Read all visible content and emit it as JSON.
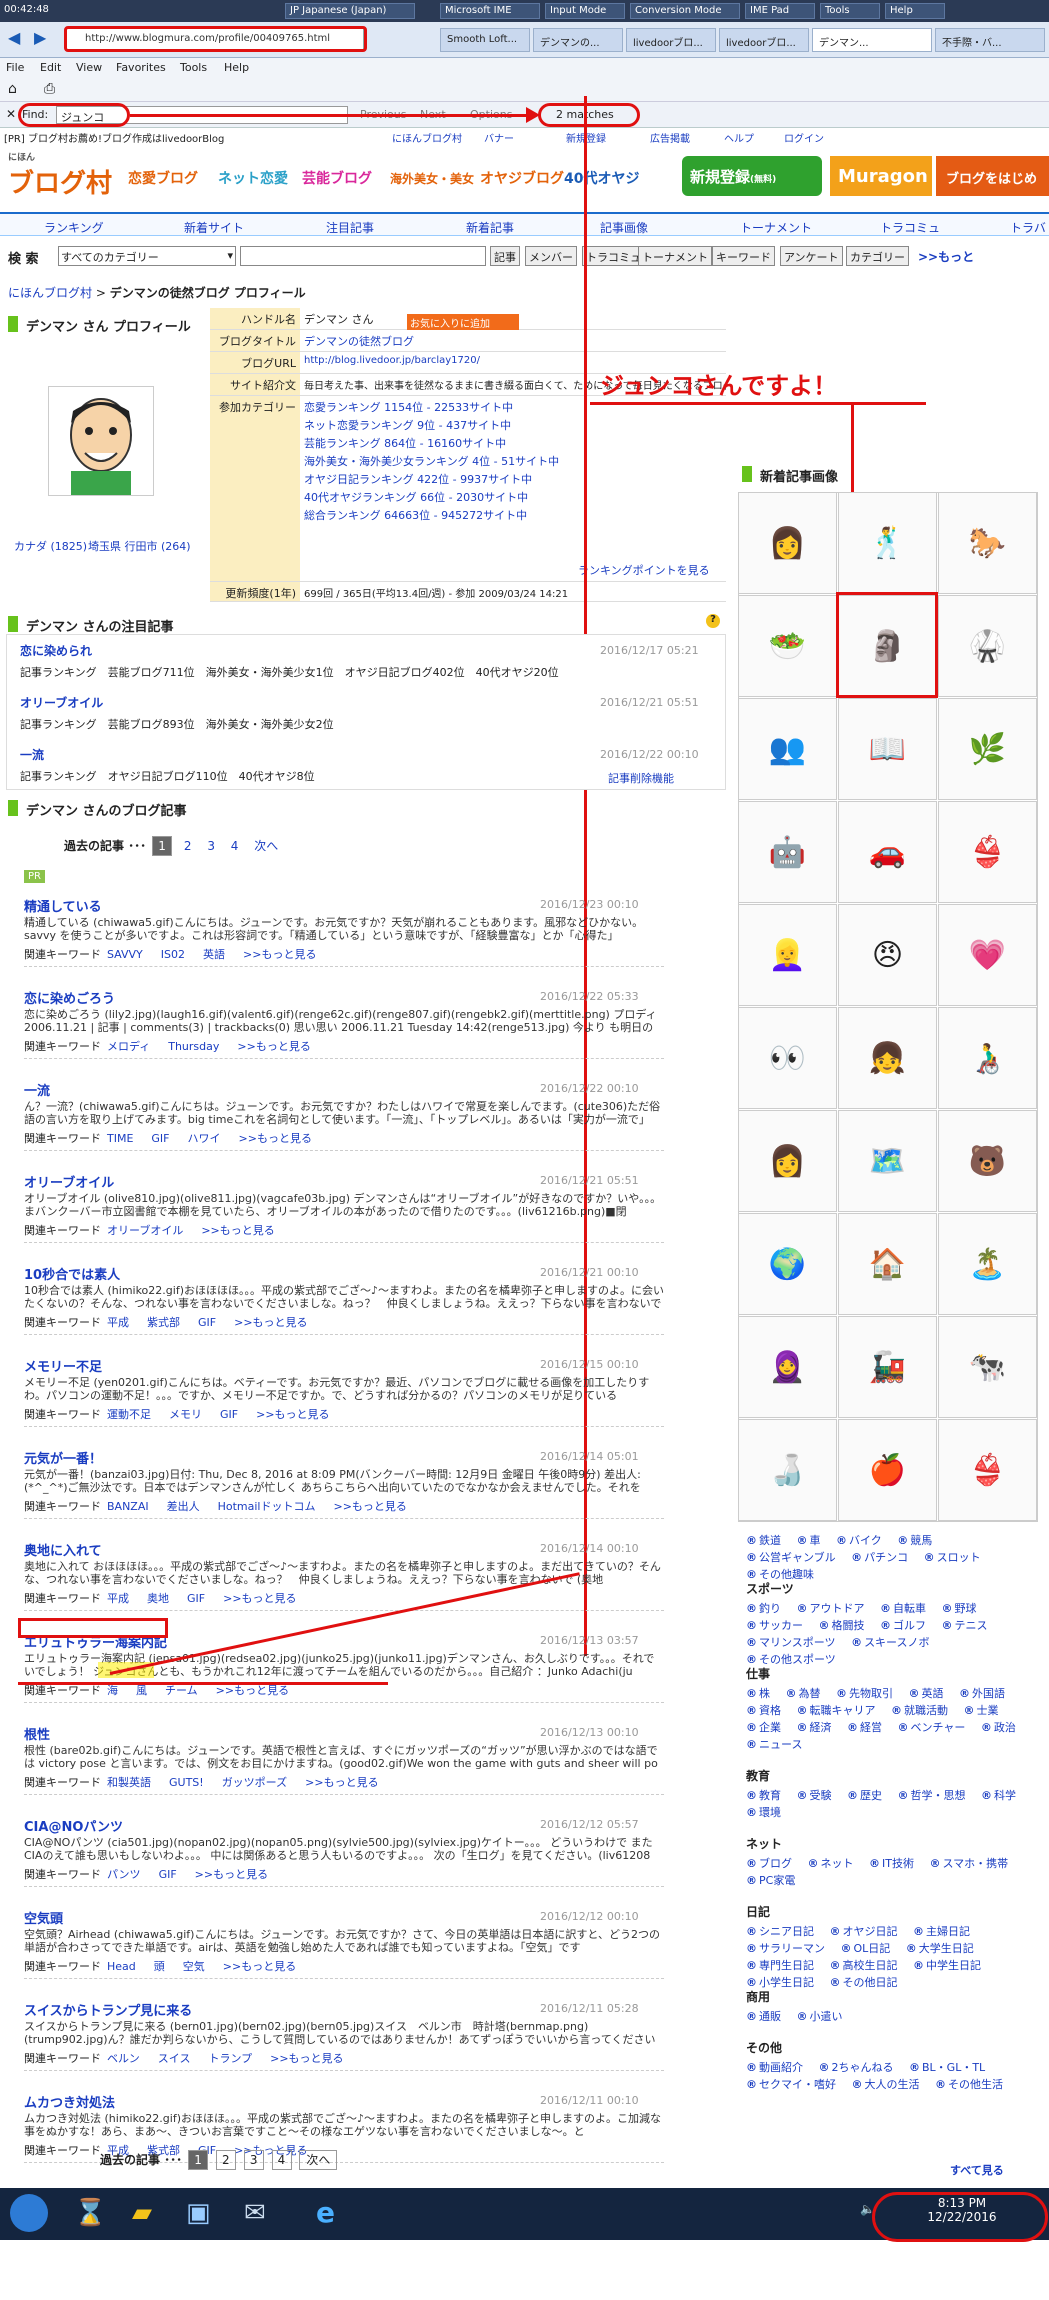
{
  "topbar": {
    "time": "00:42:48",
    "lang": "JP Japanese (Japan)",
    "ime": "Microsoft IME",
    "input_mode": "Input Mode",
    "conv_mode": "Conversion Mode",
    "ime_pad": "IME Pad",
    "tools": "Tools",
    "help": "Help"
  },
  "browser": {
    "url": "http://www.blogmura.com/profile/00409765.html",
    "tabs": [
      "Smooth Loft...",
      "デンマンの...",
      "livedoorブロ...",
      "livedoorブロ...",
      "デンマン...",
      "不手際・バ..."
    ],
    "menu": [
      "File",
      "Edit",
      "View",
      "Favorites",
      "Tools",
      "Help"
    ],
    "find_label": "Find:",
    "find_value": "ジュンコ",
    "find_prev": "Previous",
    "find_next": "Next",
    "find_options": "Options",
    "find_matches": "2 matches"
  },
  "site": {
    "pr_text": "[PR] ブログ村お薦め!ブログ作成はlivedoorBlog",
    "top_links": [
      "にほんブログ村",
      "バナー",
      "新規登録",
      "広告掲載",
      "ヘルプ",
      "ログイン"
    ],
    "logo": "ブログ村",
    "logo_sub": "にほん",
    "categories": [
      "恋愛ブログ",
      "ネット恋愛",
      "芸能ブログ",
      "海外美女・美女",
      "オヤジブログ",
      "40代オヤジ"
    ],
    "register": "新規登録",
    "register_sub": "(無料)",
    "muragon": "Muragon",
    "blog_start": "ブログをはじめ",
    "nav": [
      "ランキング",
      "新着サイト",
      "注目記事",
      "新着記事",
      "記事画像",
      "トーナメント",
      "トラコミュ",
      "トラバ"
    ],
    "search_label": "検 索",
    "search_select": "すべてのカテゴリー",
    "search_buttons": [
      "記事",
      "メンバー",
      "トラコミュ",
      "トーナメント",
      "キーワード",
      "アンケート",
      "カテゴリー"
    ],
    "search_more": ">>もっと",
    "breadcrumb_home": "にほんブログ村",
    "breadcrumb_current": "デンマンの徒然ブログ プロフィール"
  },
  "profile": {
    "title": "デンマン さん プロフィール",
    "handle_label": "ハンドル名",
    "handle": "デンマン さん",
    "add_fav": "お気に入りに追加",
    "blog_title_label": "ブログタイトル",
    "blog_title": "デンマンの徒然ブログ",
    "blog_url_label": "ブログURL",
    "blog_url": "http://blog.livedoor.jp/barclay1720/",
    "intro_label": "サイト紹介文",
    "intro": "毎日考えた事、出来事を徒然なるままに書き綴る面白くて、ためになって毎日見たくなるブログです。",
    "cat_label": "参加カテゴリー",
    "cats": [
      "恋愛ランキング 1154位 - 22533サイト中",
      "ネット恋愛ランキング 9位 - 437サイト中",
      "芸能ランキング 864位 - 16160サイト中",
      "海外美女・海外美少女ランキング 4位 - 51サイト中",
      "オヤジ日記ランキング 422位 - 9937サイト中",
      "40代オヤジランキング 66位 - 2030サイト中",
      "総合ランキング 64663位 - 945272サイト中"
    ],
    "rank_point": "ランキングポイントを見る",
    "freq_label": "更新頻度(1年)",
    "freq": "699回 / 365日(平均13.4回/週) - 参加 2009/03/24 14:21",
    "loc1": "カナダ (1825)",
    "loc2": "埼玉県 行田市 (264)"
  },
  "annotation": "ジュンコさんですよ！",
  "featured": {
    "title": "デンマン さんの注目記事",
    "items": [
      {
        "title": "恋に染められ",
        "date": "2016/12/17 05:21",
        "kw": "記事ランキング　芸能ブログ711位　海外美女・海外美少女1位　オヤジ日記ブログ402位　40代オヤジ20位"
      },
      {
        "title": "オリーブオイル",
        "date": "2016/12/21 05:51",
        "kw": "記事ランキング　芸能ブログ893位　海外美女・海外美少女2位"
      },
      {
        "title": "一流",
        "date": "2016/12/22 00:10",
        "kw": "記事ランキング　オヤジ日記ブログ110位　40代オヤジ8位"
      }
    ],
    "delete_link": "記事削除機能"
  },
  "blog": {
    "title": "デンマン さんのブログ記事",
    "pager_label": "過去の記事 ･･･",
    "pages": [
      "1",
      "2",
      "3",
      "4"
    ],
    "next": "次へ",
    "pr": "PR",
    "kw_label": "関連キーワード",
    "more": ">>もっと見る",
    "articles": [
      {
        "title": "精通している",
        "date": "2016/12/23 00:10",
        "body": "精通している (chiwawa5.gif)こんにちは。ジューンです。お元気ですか？天気が崩れることもあります。風邪などひかない。savvy を使うことが多いですよ。これは形容詞です。「精通している」という意味ですが、「経験豊富な」とか「心得た」",
        "kw": [
          "SAVVY",
          "IS02",
          "英語"
        ]
      },
      {
        "title": "恋に染めごろう",
        "date": "2016/12/22 05:33",
        "body": "恋に染めごろう (lily2.jpg)(laugh16.gif)(valent6.gif)(renge62c.gif)(renge807.gif)(rengebk2.gif)(merttitle.png) プロディ 2006.11.21 | 記事 | comments(3) | trackbacks(0) 思い思い 2006.11.21 Tuesday 14:42(renge513.jpg) 今より も明日の 思いのとめどない",
        "kw": [
          "メロディ",
          "Thursday"
        ]
      },
      {
        "title": "一流",
        "date": "2016/12/22 00:10",
        "body": "ん？一流？(chiwawa5.gif)こんにちは。ジューンです。お元気ですか？わたしはハワイで常夏を楽しんでます。(cute306)ただ俗語の言い方を取り上げてみます。big timeこれを名詞句として使います。「一流」、「トップレベル」。あるいは「実力が一流で」",
        "kw": [
          "TIME",
          "GIF",
          "ハワイ"
        ]
      },
      {
        "title": "オリーブオイル",
        "date": "2016/12/21 05:51",
        "body": "オリーブオイル (olive810.jpg)(olive811.jpg)(vagcafe03b.jpg) デンマンさんは“オリーブオイル”が好きなのですか？いや。。。まバンクーバー市立図書館で本棚を見ていたら、オリーブオイルの本があったので借りたのです。。。(liv61216b.png)■閉",
        "kw": [
          "オリーブオイル"
        ]
      },
      {
        "title": "10秒合では素人",
        "date": "2016/12/21 00:10",
        "body": "10秒合では素人 (himiko22.gif)おほほほほ。。。平成の紫式部でござ～♪～ますわよ。またの名を橘卑弥子と申しますのよ。に会いたくないの？そんな、つれない事を言わないでくださいましな。ねっ？　仲良くしましょうね。ええっ？下らない事を言わないで",
        "kw": [
          "平成",
          "紫式部",
          "GIF"
        ]
      },
      {
        "title": "メモリー不足",
        "date": "2016/12/15 00:10",
        "body": "メモリー不足 (yen0201.gif)こんにちは。ベティーです。お元気ですか？最近、パソコンでブログに載せる画像を加工したりすわ。パソコンの運動不足！。。。ですか、メモリー不足ですか。で、どうすれば分かるの？パソコンのメモリが足りている",
        "kw": [
          "運動不足",
          "メモリ",
          "GIF"
        ]
      },
      {
        "title": "元気が一番！",
        "date": "2016/12/14 05:01",
        "body": "元気が一番！(banzai03.jpg)日付: Thu, Dec 8, 2016 at 8:09 PM(バンクーバー時間: 12月9日 金曜日 午後0時9分) 差出人: (*^_^*)ご無沙汰です。日本ではデンマンさんが忙しく あちらこちらへ出向いていたのでなかなか会えませんでした。それを",
        "kw": [
          "BANZAI",
          "差出人",
          "Hotmailドットコム"
        ]
      },
      {
        "title": "奥地に入れて",
        "date": "2016/12/14 00:10",
        "body": "奥地に入れて おほほほほ。。。平成の紫式部でござ～♪～ますわよ。またの名を橘卑弥子と申しますのよ。まだ出てきていの？そんな、つれない事を言わないでくださいましな。ねっ？　仲良くしましょうね。ええっ？下らない事を言わないで (奥地",
        "kw": [
          "平成",
          "奥地",
          "GIF"
        ]
      },
      {
        "title": "エリュトゥラー海案内記",
        "date": "2016/12/13 03:57",
        "body": "エリュトゥラー海案内記 (iensa01.jpg)(redsea02.jpg)(junko25.jpg)(junko11.jpg)デンマンさん、お久しぶりです。。。それでいでしょう！ ジュンコさんとも、もうかれこれ12年に渡ってチームを組んでいるのだから。。。自己紹介 ：Junko Adachi(ju",
        "kw": [
          "海",
          "風",
          "チーム"
        ]
      },
      {
        "title": "根性",
        "date": "2016/12/13 00:10",
        "body": "根性 (bare02b.gif)こんにちは。ジューンです。英語で根性と言えば、すぐにガッツポーズの“ガッツ”が思い浮かぶのではな語では victory pose と言います。では、例文をお目にかけますね。(good02.gif)We won the game with guts and sheer will po",
        "kw": [
          "和製英語",
          "GUTS!",
          "ガッツポーズ"
        ]
      },
      {
        "title": "CIA@NOパンツ",
        "date": "2016/12/12 05:57",
        "body": "CIA@NOパンツ (cia501.jpg)(nopan02.jpg)(nopan05.png)(sylvie500.jpg)(sylviex.jpg)ケイトー。。。 どういうわけで またCIAのえて誰も思いもしないわよ。。。 中には関係あると思う人もいるのですよ。。。 次の「生ログ」を見てください。(liv61208",
        "kw": [
          "パンツ",
          "GIF"
        ]
      },
      {
        "title": "空気頭",
        "date": "2016/12/12 00:10",
        "body": "空気頭？Airhead (chiwawa5.gif)こんにちは。ジューンです。お元気ですか？さて、今日の英単語は日本語に訳すと、どう2つの単語が合わさってできた単語です。airは、英語を勉強し始めた人であれば誰でも知っていますよね。「空気」です",
        "kw": [
          "Head",
          "頭",
          "空気"
        ]
      },
      {
        "title": "スイスからトランプ見に来る",
        "date": "2016/12/11 05:28",
        "body": "スイスからトランプ見に来る (bern01.jpg)(bern02.jpg)(bern05.jpg)スイス　ベルン市　時計塔(bernmap.png)(trump902.jpg)ん？誰だか判らないから、こうして質問しているのではありませんか！あてずっぽうでいいから言ってください",
        "kw": [
          "ベルン",
          "スイス",
          "トランプ"
        ]
      },
      {
        "title": "ムカつき対処法",
        "date": "2016/12/11 00:10",
        "body": "ムカつき対処法 (himiko22.gif)おほほほ。。。平成の紫式部でござ～♪～ますわよ。またの名を橘卑弥子と申しますのよ。こ加減な事をぬかすな！あら、まあ～、きついお言葉ですこと～その様なエゲツない事を言わないでくださいましな～。と",
        "kw": [
          "平成",
          "紫式部",
          "GIF"
        ]
      }
    ]
  },
  "sidebar": {
    "new_images_title": "新着記事画像",
    "image_icons": [
      "👩",
      "🕺",
      "🐎",
      "🥗",
      "🗿",
      "🥋",
      "👥",
      "📖",
      "🌿",
      "🤖",
      "🚗",
      "👙",
      "👱‍♀️",
      "😠",
      "💗",
      "👀",
      "👧",
      "👨‍🦽",
      "👩",
      "🗺️",
      "🐻",
      "🌍",
      "🏠",
      "🏝️",
      "🧕",
      "🚂",
      "🐄",
      "🍶",
      "🍎",
      "👙"
    ],
    "groups": [
      {
        "title": "",
        "items": [
          "鉄道",
          "車",
          "バイク",
          "競馬",
          "公営ギャンブル",
          "パチンコ",
          "スロット",
          "その他趣味"
        ]
      },
      {
        "title": "スポーツ",
        "items": [
          "釣り",
          "アウトドア",
          "自転車",
          "野球",
          "サッカー",
          "格闘技",
          "ゴルフ",
          "テニス",
          "マリンスポーツ",
          "スキースノボ",
          "その他スポーツ"
        ]
      },
      {
        "title": "仕事",
        "items": [
          "株",
          "為替",
          "先物取引",
          "英語",
          "外国語",
          "資格",
          "転職キャリア",
          "就職活動",
          "士業",
          "企業",
          "経済",
          "経営",
          "ベンチャー",
          "政治",
          "ニュース"
        ]
      },
      {
        "title": "教育",
        "items": [
          "教育",
          "受験",
          "歴史",
          "哲学・思想",
          "科学",
          "環境"
        ]
      },
      {
        "title": "ネット",
        "items": [
          "ブログ",
          "ネット",
          "IT技術",
          "スマホ・携帯",
          "PC家電"
        ]
      },
      {
        "title": "日記",
        "items": [
          "シニア日記",
          "オヤジ日記",
          "主婦日記",
          "サラリーマン",
          "OL日記",
          "大学生日記",
          "専門生日記",
          "高校生日記",
          "中学生日記",
          "小学生日記",
          "その他日記"
        ]
      },
      {
        "title": "商用",
        "items": [
          "通販",
          "小遣い"
        ]
      },
      {
        "title": "その他",
        "items": [
          "動画紹介",
          "2ちゃんねる",
          "BL・GL・TL",
          "セクマイ・嗜好",
          "大人の生活",
          "その他生活"
        ]
      }
    ],
    "all_view": "すべて見る"
  },
  "taskbar": {
    "time": "8:13 PM",
    "date": "12/22/2016"
  }
}
